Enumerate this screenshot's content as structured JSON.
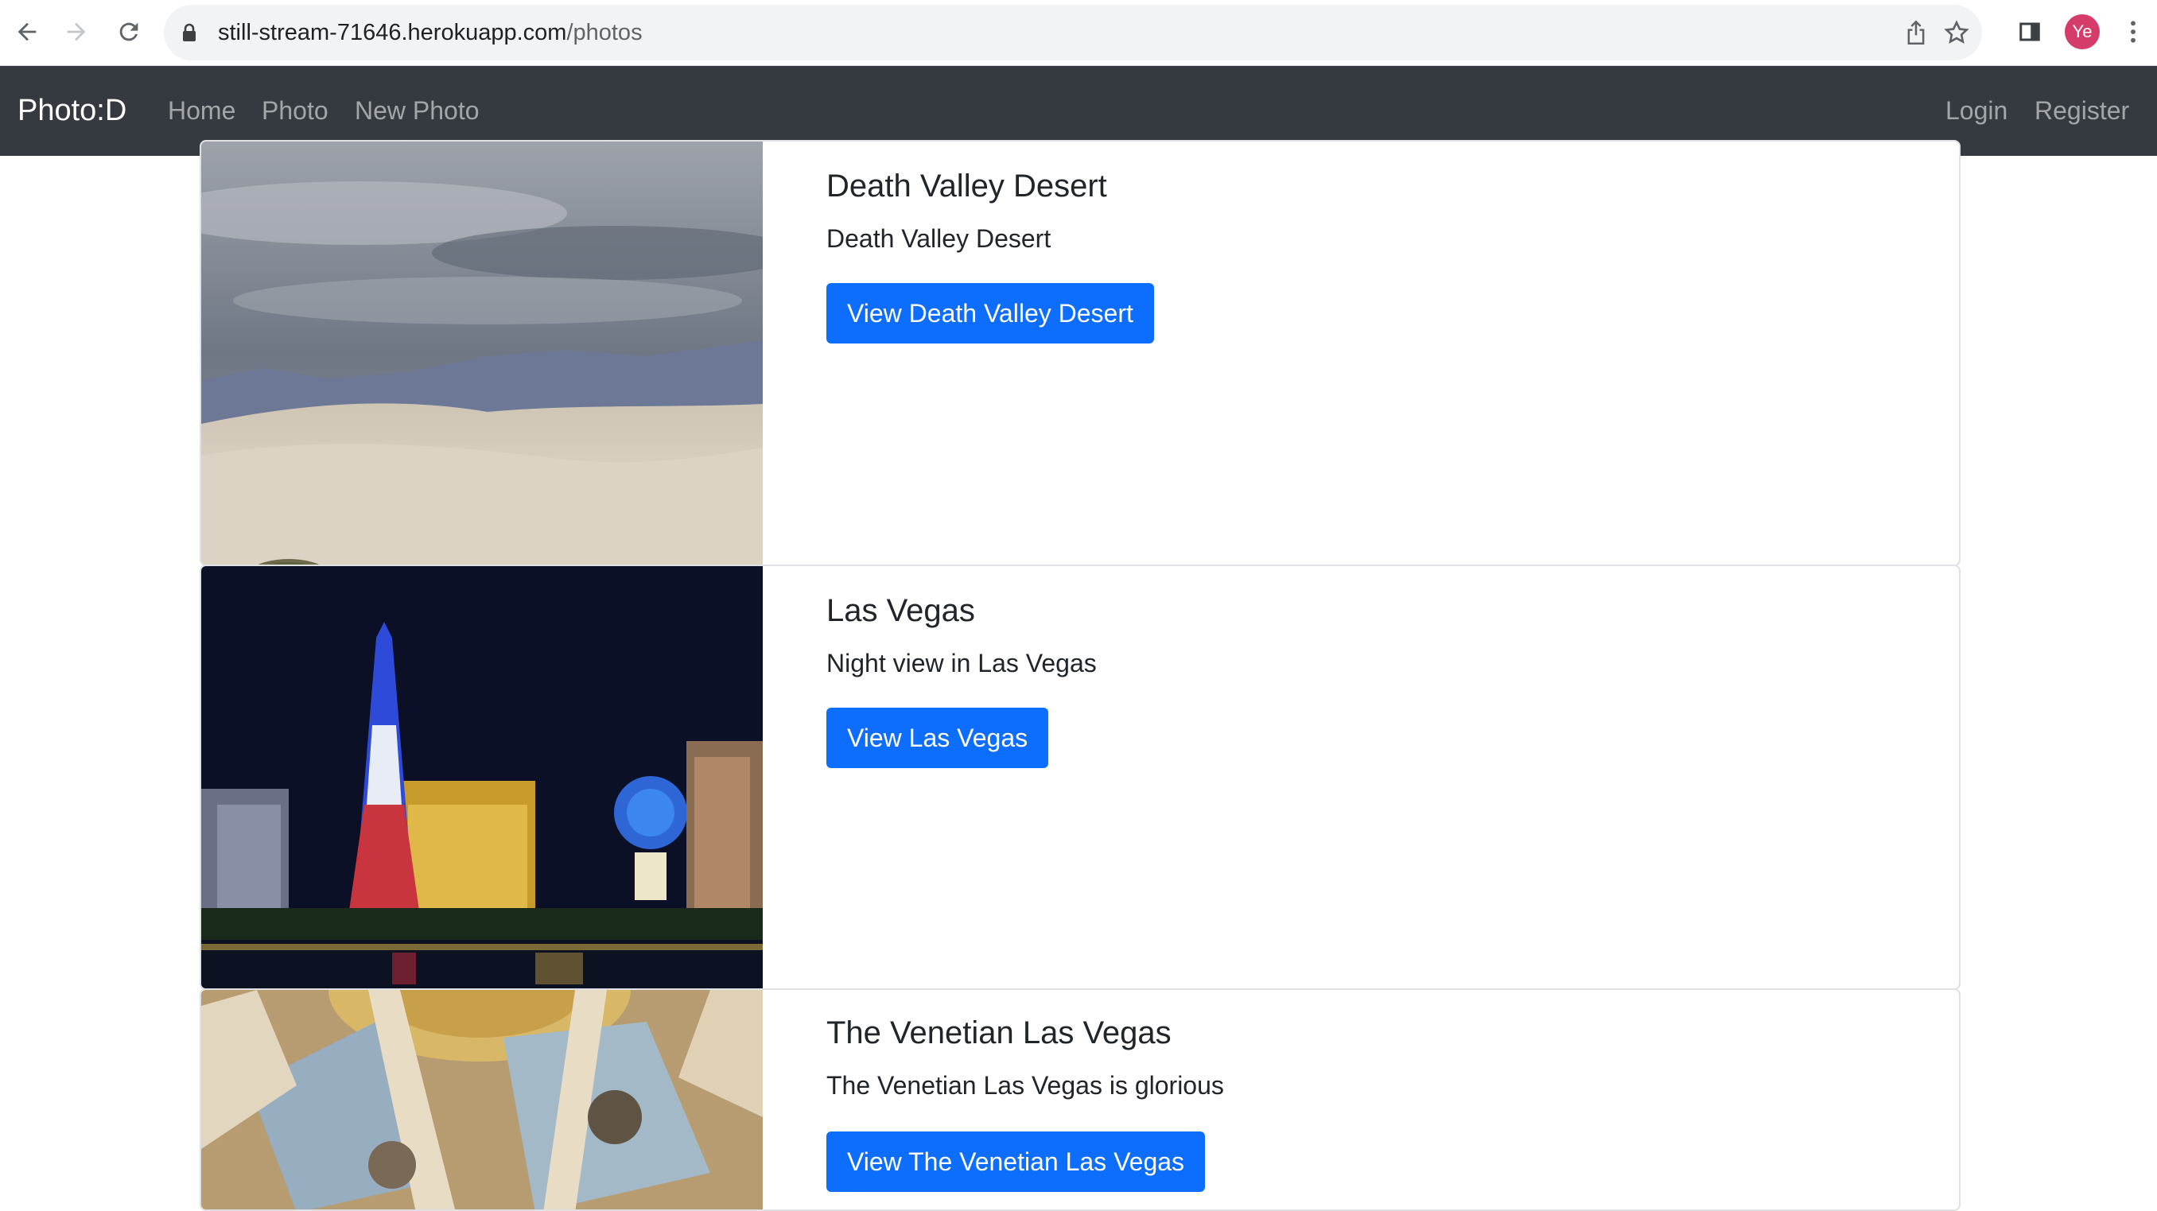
{
  "browser": {
    "url_host": "still-stream-71646.herokuapp.com",
    "url_path": "/photos",
    "profile_initials": "Ye"
  },
  "navbar": {
    "brand": "Photo:D",
    "links": [
      "Home",
      "Photo",
      "New Photo"
    ],
    "right_links": [
      "Login",
      "Register"
    ]
  },
  "photos": [
    {
      "title": "Death Valley Desert",
      "description": "Death Valley Desert",
      "button": "View Death Valley Desert"
    },
    {
      "title": "Las Vegas",
      "description": "Night view in Las Vegas",
      "button": "View Las Vegas"
    },
    {
      "title": "The Venetian Las Vegas",
      "description": "The Venetian Las Vegas is glorious",
      "button": "View The Venetian Las Vegas"
    }
  ],
  "colors": {
    "navbar_bg": "#343a40",
    "primary_button": "#0d6efd"
  }
}
